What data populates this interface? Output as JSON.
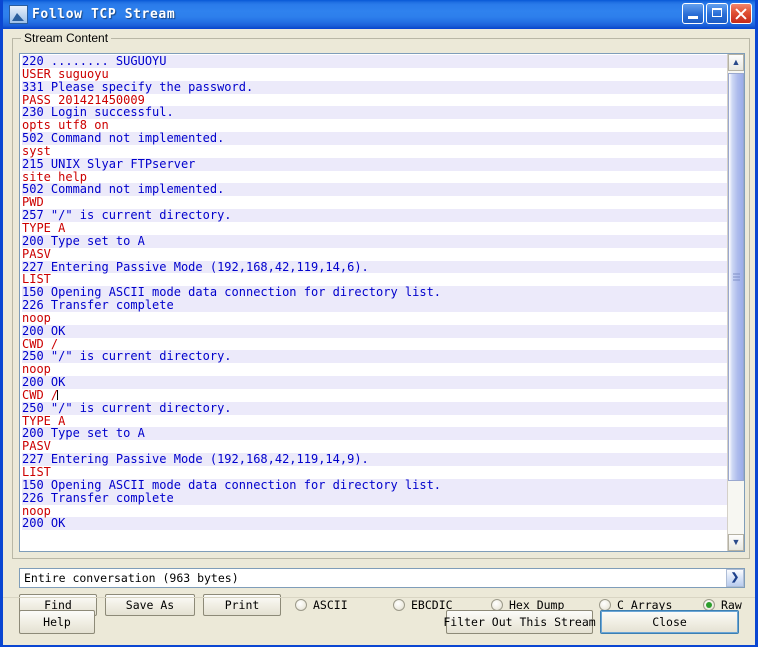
{
  "window": {
    "title": "Follow TCP Stream",
    "icon": "wireshark-shark-fin-icon",
    "minimize_label": "Minimize",
    "maximize_label": "Maximize",
    "close_label": "Close"
  },
  "group": {
    "label": "Stream Content"
  },
  "stream": {
    "lines": [
      {
        "dir": "srv",
        "text": "220 ........ SUGUOYU"
      },
      {
        "dir": "cli",
        "text": "USER suguoyu"
      },
      {
        "dir": "srv",
        "text": "331 Please specify the password."
      },
      {
        "dir": "cli",
        "text": "PASS 201421450009"
      },
      {
        "dir": "srv",
        "text": "230 Login successful."
      },
      {
        "dir": "cli",
        "text": "opts utf8 on"
      },
      {
        "dir": "srv",
        "text": "502 Command not implemented."
      },
      {
        "dir": "cli",
        "text": "syst"
      },
      {
        "dir": "srv",
        "text": "215 UNIX Slyar FTPserver"
      },
      {
        "dir": "cli",
        "text": "site help"
      },
      {
        "dir": "srv",
        "text": "502 Command not implemented."
      },
      {
        "dir": "cli",
        "text": "PWD"
      },
      {
        "dir": "srv",
        "text": "257 \"/\" is current directory."
      },
      {
        "dir": "cli",
        "text": "TYPE A"
      },
      {
        "dir": "srv",
        "text": "200 Type set to A"
      },
      {
        "dir": "cli",
        "text": "PASV"
      },
      {
        "dir": "srv",
        "text": "227 Entering Passive Mode (192,168,42,119,14,6)."
      },
      {
        "dir": "cli",
        "text": "LIST"
      },
      {
        "dir": "srv",
        "text": "150 Opening ASCII mode data connection for directory list."
      },
      {
        "dir": "srv",
        "text": "226 Transfer complete"
      },
      {
        "dir": "cli",
        "text": "noop"
      },
      {
        "dir": "srv",
        "text": "200 OK"
      },
      {
        "dir": "cli",
        "text": "CWD /"
      },
      {
        "dir": "srv",
        "text": "250 \"/\" is current directory."
      },
      {
        "dir": "cli",
        "text": "noop"
      },
      {
        "dir": "srv",
        "text": "200 OK"
      },
      {
        "dir": "cli",
        "text": "CWD /",
        "caret": true
      },
      {
        "dir": "srv",
        "text": "250 \"/\" is current directory."
      },
      {
        "dir": "cli",
        "text": "TYPE A"
      },
      {
        "dir": "srv",
        "text": "200 Type set to A"
      },
      {
        "dir": "cli",
        "text": "PASV"
      },
      {
        "dir": "srv",
        "text": "227 Entering Passive Mode (192,168,42,119,14,9)."
      },
      {
        "dir": "cli",
        "text": "LIST"
      },
      {
        "dir": "srv",
        "text": "150 Opening ASCII mode data connection for directory list."
      },
      {
        "dir": "srv",
        "text": "226 Transfer complete"
      },
      {
        "dir": "cli",
        "text": "noop"
      },
      {
        "dir": "srv",
        "text": "200 OK"
      }
    ],
    "colors": {
      "server_text": "#0000cc",
      "server_background": "#eceafa",
      "client_text": "#cc0000",
      "client_background": "#ffffff"
    }
  },
  "scrollbar": {
    "up_arrow": "chevron-up-icon",
    "down_arrow": "chevron-down-icon"
  },
  "conversation_select": {
    "value": "Entire conversation (963 bytes)",
    "arrow": "chevron-down-icon"
  },
  "toolbar": {
    "find_label": "Find",
    "save_as_label": "Save As",
    "print_label": "Print",
    "formats": [
      {
        "label": "ASCII",
        "selected": false
      },
      {
        "label": "EBCDIC",
        "selected": false
      },
      {
        "label": "Hex Dump",
        "selected": false
      },
      {
        "label": "C Arrays",
        "selected": false
      },
      {
        "label": "Raw",
        "selected": true
      }
    ],
    "selected_format": "Raw",
    "selected_radio_color": "#2c9e2c"
  },
  "footer": {
    "help_label": "Help",
    "filter_label": "Filter Out This Stream",
    "close_label": "Close"
  }
}
